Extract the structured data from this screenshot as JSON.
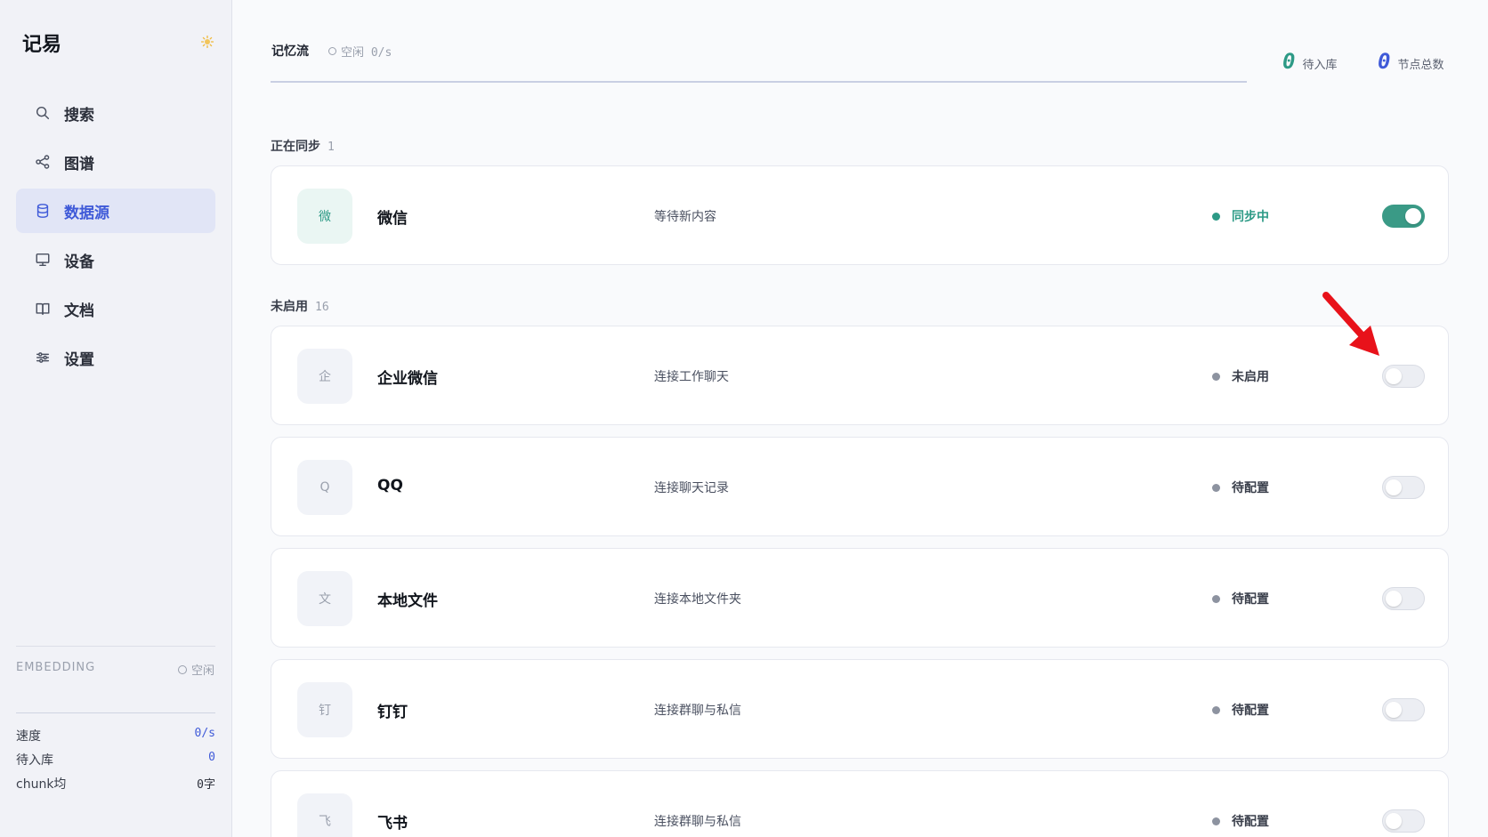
{
  "app": {
    "name": "记易"
  },
  "sidebar": {
    "items": [
      {
        "label": "搜索",
        "icon": "search-icon"
      },
      {
        "label": "图谱",
        "icon": "share-graph-icon"
      },
      {
        "label": "数据源",
        "icon": "database-icon"
      },
      {
        "label": "设备",
        "icon": "monitor-icon"
      },
      {
        "label": "文档",
        "icon": "book-icon"
      },
      {
        "label": "设置",
        "icon": "sliders-icon"
      }
    ],
    "embedding": {
      "title": "EMBEDDING",
      "status": "空闲",
      "stats": [
        {
          "label": "速度",
          "value": "0/s"
        },
        {
          "label": "待入库",
          "value": "0"
        },
        {
          "label": "chunk均",
          "value": "0字"
        }
      ]
    }
  },
  "header": {
    "tab": "记忆流",
    "status": "空闲 0/s",
    "metrics": [
      {
        "value": "0",
        "label": "待入库",
        "color": "#2d9a86"
      },
      {
        "value": "0",
        "label": "节点总数",
        "color": "#3f5ad8"
      }
    ]
  },
  "sections": {
    "syncing": {
      "title": "正在同步",
      "count": "1"
    },
    "disabled": {
      "title": "未启用",
      "count": "16"
    }
  },
  "sources": [
    {
      "badge": "微",
      "name": "微信",
      "desc": "等待新内容",
      "status": "同步中",
      "enabled": true
    },
    {
      "badge": "企",
      "name": "企业微信",
      "desc": "连接工作聊天",
      "status": "未启用",
      "enabled": false
    },
    {
      "badge": "Q",
      "name": "QQ",
      "desc": "连接聊天记录",
      "status": "待配置",
      "enabled": false
    },
    {
      "badge": "文",
      "name": "本地文件",
      "desc": "连接本地文件夹",
      "status": "待配置",
      "enabled": false
    },
    {
      "badge": "钉",
      "name": "钉钉",
      "desc": "连接群聊与私信",
      "status": "待配置",
      "enabled": false
    },
    {
      "badge": "飞",
      "name": "飞书",
      "desc": "连接群聊与私信",
      "status": "待配置",
      "enabled": false
    }
  ],
  "colors": {
    "accent": "#3f5ad8",
    "sync_green": "#2d9a86",
    "annotation_arrow": "#e8121a"
  }
}
